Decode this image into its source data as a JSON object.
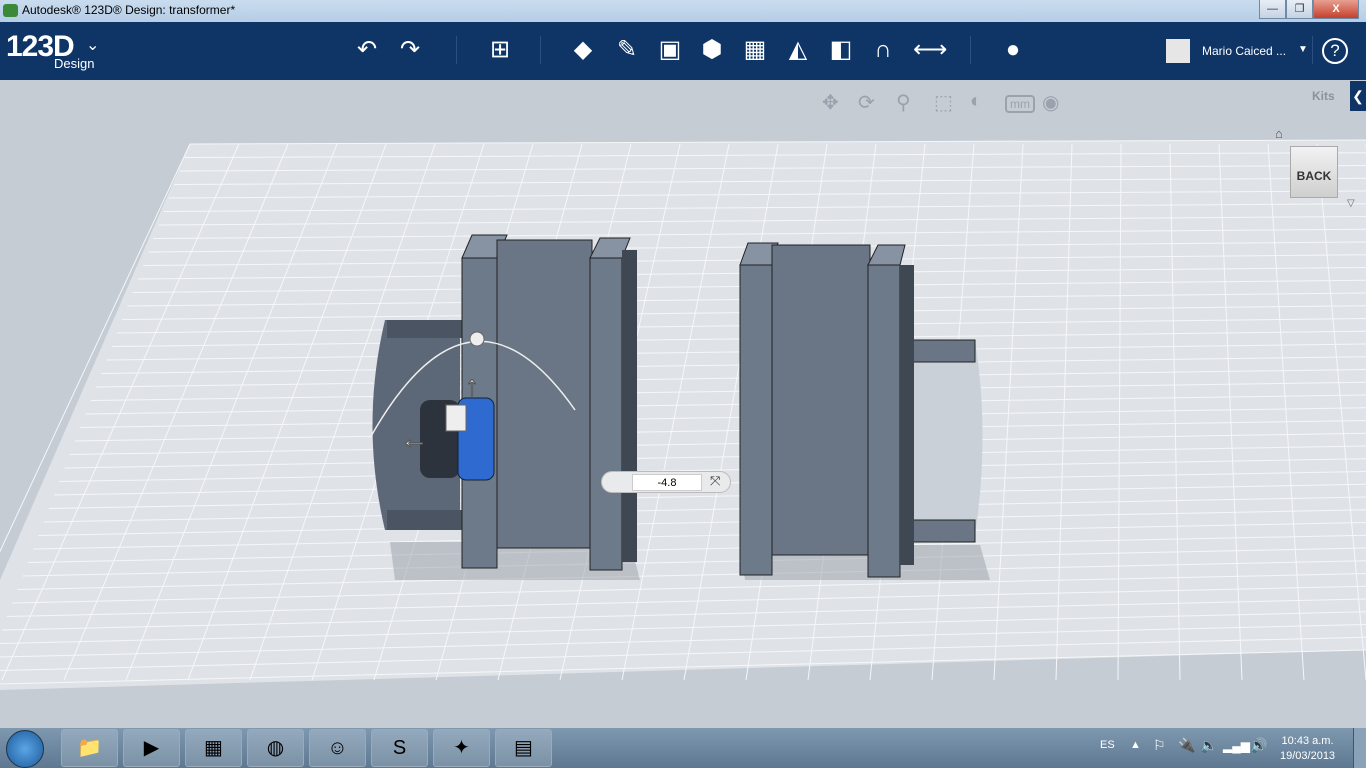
{
  "window": {
    "title": "Autodesk® 123D® Design: transformer*",
    "minimize": "—",
    "restore": "❐",
    "close": "X"
  },
  "toolbar": {
    "logo": "123D",
    "logo_sub": "Design",
    "tools": [
      {
        "icon": "undo-icon",
        "glyph": "↶"
      },
      {
        "icon": "redo-icon",
        "glyph": "↷"
      },
      {
        "icon": "transform-icon",
        "glyph": "⊞"
      },
      {
        "icon": "primitives-icon",
        "glyph": "◆"
      },
      {
        "icon": "sketch-icon",
        "glyph": "✎"
      },
      {
        "icon": "construct-icon",
        "glyph": "▣"
      },
      {
        "icon": "modify-icon",
        "glyph": "⬢"
      },
      {
        "icon": "pattern-icon",
        "glyph": "▦"
      },
      {
        "icon": "grouping-icon",
        "glyph": "◭"
      },
      {
        "icon": "combine-icon",
        "glyph": "◧"
      },
      {
        "icon": "snap-icon",
        "glyph": "∩"
      },
      {
        "icon": "measure-icon",
        "glyph": "⟷"
      },
      {
        "icon": "material-icon",
        "glyph": "●"
      }
    ],
    "user": "Mario Caiced ...",
    "help": "?"
  },
  "nav": {
    "tools": [
      {
        "icon": "pan-icon",
        "glyph": "✥"
      },
      {
        "icon": "orbit-icon",
        "glyph": "⟳"
      },
      {
        "icon": "zoom-icon",
        "glyph": "⚲"
      },
      {
        "icon": "fit-icon",
        "glyph": "⬚"
      },
      {
        "icon": "view-mode-icon",
        "glyph": "◐"
      },
      {
        "icon": "units-icon",
        "glyph": "mm"
      },
      {
        "icon": "visibility-icon",
        "glyph": "◉"
      }
    ],
    "kits": "Kits",
    "viewcube": "BACK"
  },
  "move_input": {
    "value": "-4.8"
  },
  "taskbar": {
    "apps": [
      {
        "icon": "explorer-icon",
        "glyph": "📁"
      },
      {
        "icon": "media-player-icon",
        "glyph": "▶"
      },
      {
        "icon": "app-icon",
        "glyph": "▦"
      },
      {
        "icon": "firefox-icon",
        "glyph": "◍"
      },
      {
        "icon": "messenger-icon",
        "glyph": "☺"
      },
      {
        "icon": "skype-icon",
        "glyph": "S"
      },
      {
        "icon": "123d-icon",
        "glyph": "✦"
      },
      {
        "icon": "calculator-icon",
        "glyph": "▤"
      }
    ],
    "lang": "ES",
    "time": "10:43 a.m.",
    "date": "19/03/2013"
  }
}
